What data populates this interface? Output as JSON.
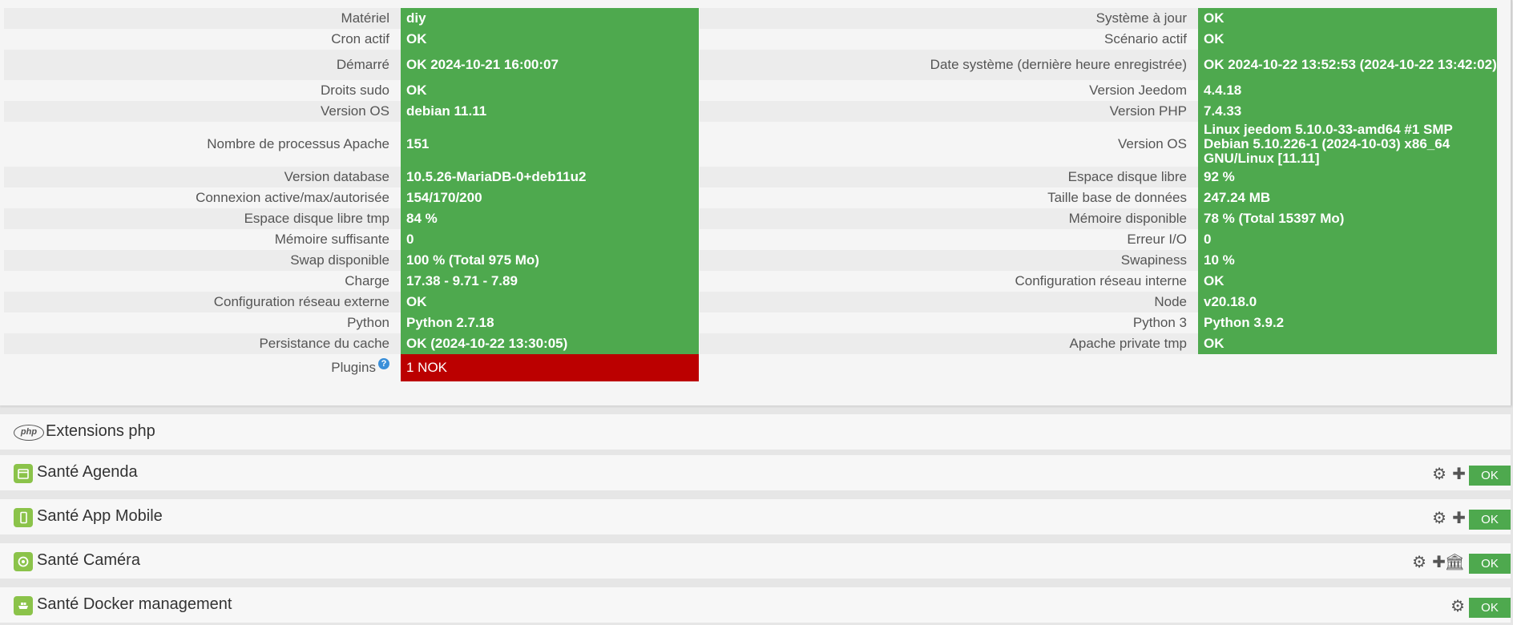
{
  "health": {
    "left": [
      {
        "label": "Matériel",
        "value": "diy"
      },
      {
        "label": "Cron actif",
        "value": "OK"
      },
      {
        "label": "Démarré",
        "value": "OK 2024-10-21 16:00:07"
      },
      {
        "label": "Droits sudo",
        "value": "OK"
      },
      {
        "label": "Version OS",
        "value": "debian 11.11"
      },
      {
        "label": "Nombre de processus Apache",
        "value": "151"
      },
      {
        "label": "Version database",
        "value": "10.5.26-MariaDB-0+deb11u2"
      },
      {
        "label": "Connexion active/max/autorisée",
        "value": "154/170/200"
      },
      {
        "label": "Espace disque libre tmp",
        "value": "84 %"
      },
      {
        "label": "Mémoire suffisante",
        "value": "0"
      },
      {
        "label": "Swap disponible",
        "value": "100 % (Total 975 Mo)"
      },
      {
        "label": "Charge",
        "value": "17.38 - 9.71 - 7.89"
      },
      {
        "label": "Configuration réseau externe",
        "value": "OK"
      },
      {
        "label": "Python",
        "value": "Python 2.7.18"
      },
      {
        "label": "Persistance du cache",
        "value": "OK (2024-10-22 13:30:05)"
      },
      {
        "label": "Plugins",
        "value": "1 NOK",
        "help": "?"
      }
    ],
    "right": [
      {
        "label": "Système à jour",
        "value": "OK"
      },
      {
        "label": "Scénario actif",
        "value": "OK"
      },
      {
        "label": "Date système (dernière heure enregistrée)",
        "value": "OK 2024-10-22 13:52:53 (2024-10-22 13:42:02)"
      },
      {
        "label": "Version Jeedom",
        "value": "4.4.18"
      },
      {
        "label": "Version PHP",
        "value": "7.4.33"
      },
      {
        "label": "Version OS",
        "value": "Linux jeedom 5.10.0-33-amd64 #1 SMP Debian 5.10.226-1 (2024-10-03) x86_64 GNU/Linux [11.11]"
      },
      {
        "label": "Espace disque libre",
        "value": "92 %"
      },
      {
        "label": "Taille base de données",
        "value": "247.24 MB"
      },
      {
        "label": "Mémoire disponible",
        "value": "78 % (Total 15397 Mo)"
      },
      {
        "label": "Erreur I/O",
        "value": "0"
      },
      {
        "label": "Swapiness",
        "value": "10 %"
      },
      {
        "label": "Configuration réseau interne",
        "value": "OK"
      },
      {
        "label": "Node",
        "value": "v20.18.0"
      },
      {
        "label": "Python 3",
        "value": "Python 3.9.2"
      },
      {
        "label": "Apache private tmp",
        "value": "OK"
      }
    ]
  },
  "sections": {
    "php": {
      "icon": "php",
      "title": "Extensions php"
    },
    "agenda": {
      "icon": "calendar-icon",
      "title": "Santé Agenda",
      "status": "OK"
    },
    "mobile": {
      "icon": "mobile-icon",
      "title": "Santé App Mobile",
      "status": "OK"
    },
    "camera": {
      "icon": "camera-icon",
      "title": "Santé Caméra",
      "status": "OK"
    },
    "docker": {
      "icon": "docker-icon",
      "title": "Santé Docker management",
      "status": "OK"
    }
  },
  "colors": {
    "ok": "#4ea94e",
    "nok": "#bb0000",
    "plugin_icon": "#8bc34a"
  }
}
